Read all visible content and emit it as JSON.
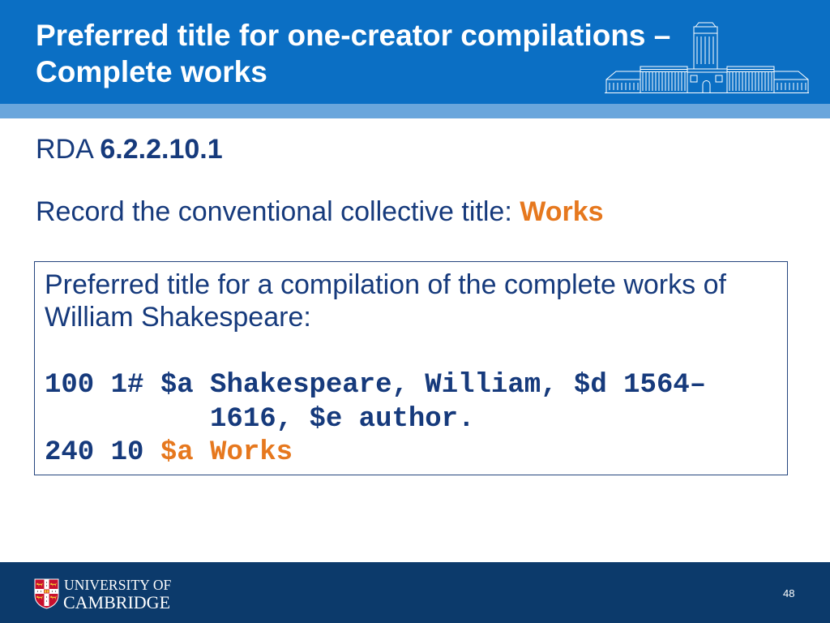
{
  "header": {
    "title_lines": [
      "Preferred title for one-creator compilations –",
      "Complete works"
    ]
  },
  "body": {
    "rule_prefix": "RDA",
    "rule_number": "6.2.2.10.1",
    "instruction": "Record the conventional collective title:",
    "instruction_highlight": "Works"
  },
  "example_box": {
    "intro_lines": [
      "Preferred title for a compilation of the complete works of",
      "William Shakespeare:"
    ],
    "marc": [
      {
        "tag": "100",
        "indicators": "1#",
        "content": "$a Shakespeare, William, $d 1564–",
        "continuation": "1616, $e author."
      },
      {
        "tag": "240",
        "indicators": "10",
        "content": "$a Works"
      }
    ]
  },
  "footer": {
    "logo_line1": "UNIVERSITY OF",
    "logo_line2": "CAMBRIDGE",
    "page_number": "48"
  },
  "icons": {
    "header_illustration": "university-library-building",
    "footer_logo": "cambridge-coat-of-arms"
  },
  "colors": {
    "header_blue": "#0b6fc4",
    "header_strip": "#6aa6dc",
    "text_navy": "#163a7c",
    "highlight_orange": "#e6781e",
    "footer_navy": "#0c3a6b"
  }
}
